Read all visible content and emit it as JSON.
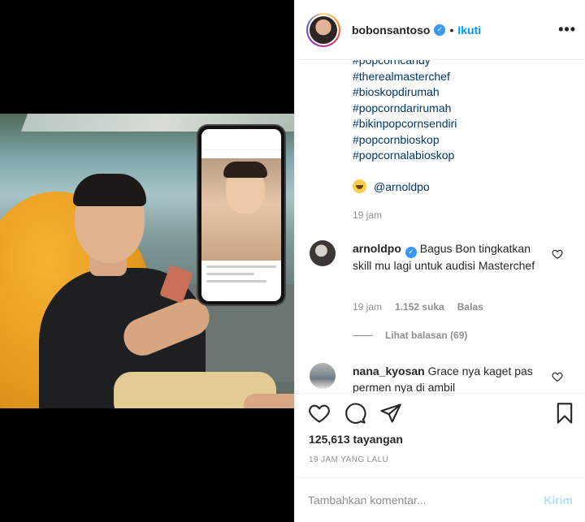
{
  "header": {
    "username": "bobonsantoso",
    "separator": "•",
    "follow_label": "Ikuti",
    "more_icon": "more-dots-icon"
  },
  "caption": {
    "hashtags": [
      "#popcorncandy",
      "#therealmasterchef",
      "#bioskopdirumah",
      "#popcorndarirumah",
      "#bikinpopcornsendiri",
      "#popcornbioskop",
      "#popcornalabioskop"
    ],
    "mention": "@arnoldpo",
    "time": "19 jam"
  },
  "comments": [
    {
      "username": "arnoldpo",
      "text": "Bagus Bon tingkatkan skill mu lagi untuk audisi Masterchef",
      "time": "19 jam",
      "likes": "1.152 suka",
      "reply_label": "Balas",
      "view_replies": "Lihat balasan (69)"
    },
    {
      "username": "nana_kyosan",
      "text": "Grace nya kaget pas permen nya di ambil"
    }
  ],
  "actions": {
    "views": "125,613 tayangan",
    "posted_ago": "19 JAM YANG LALU"
  },
  "comment_box": {
    "placeholder": "Tambahkan komentar...",
    "post_label": "Kirim"
  },
  "colors": {
    "link": "#00376b",
    "accent": "#0095f6",
    "muted": "#8e8e8e",
    "verified": "#3897f0"
  }
}
